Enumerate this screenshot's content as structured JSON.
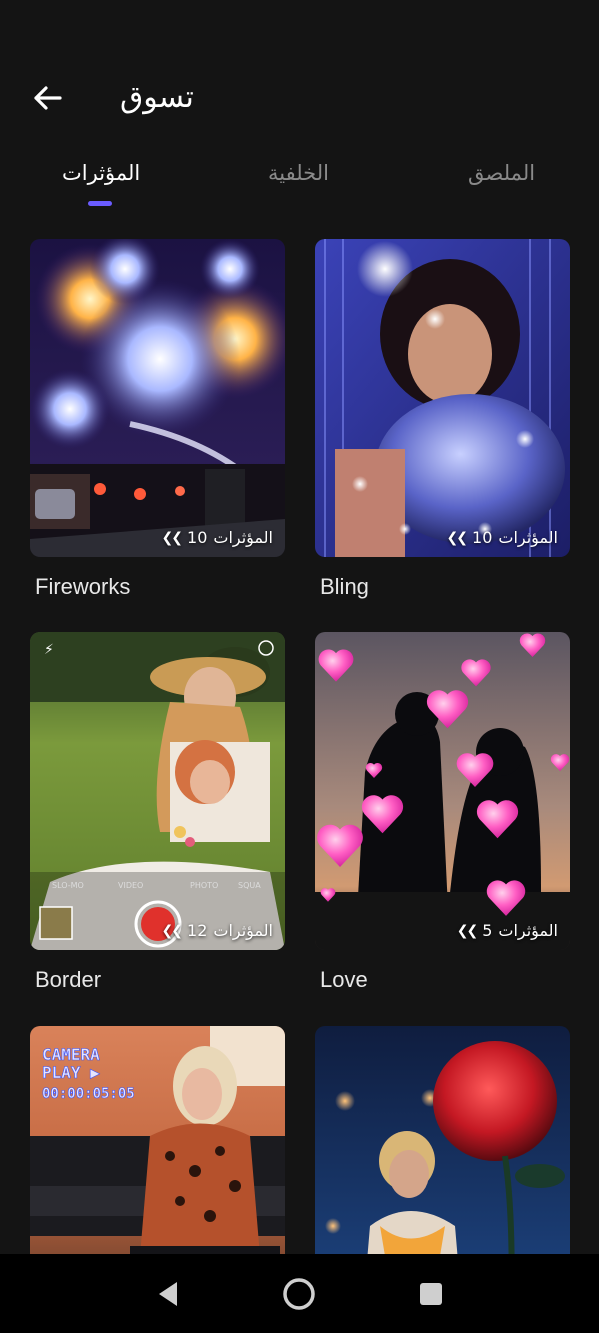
{
  "header": {
    "title": "تسوق",
    "back_icon": "arrow-left-icon"
  },
  "tabs": [
    {
      "label": "الملصق",
      "active": false
    },
    {
      "label": "الخلفية",
      "active": false
    },
    {
      "label": "المؤثرات",
      "active": true
    }
  ],
  "accent_color": "#6b5cff",
  "cards": [
    {
      "title": "Bling",
      "count": "10",
      "count_label": "المؤثرات"
    },
    {
      "title": "Fireworks",
      "count": "10",
      "count_label": "المؤثرات"
    },
    {
      "title": "Love",
      "count": "5",
      "count_label": "المؤثرات"
    },
    {
      "title": "Border",
      "count": "12",
      "count_label": "المؤثرات"
    },
    {
      "title": "",
      "count": "",
      "count_label": ""
    },
    {
      "title": "",
      "count": "",
      "count_label": ""
    }
  ],
  "camera_overlay": {
    "modes": [
      "SLO-MO",
      "VIDEO",
      "PHOTO",
      "SQUA"
    ],
    "vhs_line1": "CAMERA",
    "vhs_line2": "PLAY ▶",
    "vhs_time": "00:00:05:05"
  },
  "navbar": {
    "back": "nav-back-icon",
    "home": "nav-home-icon",
    "recents": "nav-recents-icon"
  }
}
